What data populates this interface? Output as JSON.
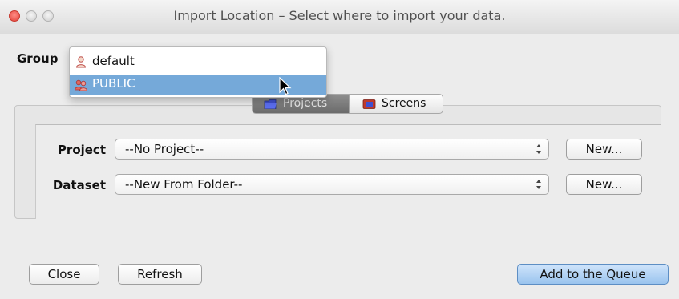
{
  "window": {
    "title": "Import Location – Select where to import your data."
  },
  "group": {
    "label": "Group",
    "options": [
      {
        "label": "default",
        "icon": "user-icon",
        "selected": false
      },
      {
        "label": "PUBLIC",
        "icon": "group-users-icon",
        "selected": true
      }
    ]
  },
  "tabs": [
    {
      "label": "Projects",
      "icon": "folder-icon",
      "active": true
    },
    {
      "label": "Screens",
      "icon": "screen-plate-icon",
      "active": false
    }
  ],
  "form": {
    "project_label": "Project",
    "project_value": "--No Project--",
    "dataset_label": "Dataset",
    "dataset_value": "--New From Folder--",
    "new_label": "New..."
  },
  "footer": {
    "close_label": "Close",
    "refresh_label": "Refresh",
    "add_label": "Add to the Queue"
  },
  "colors": {
    "selection": "#75a9d9",
    "primary_button": "#9ac4ee",
    "close_light": "#e24139"
  }
}
